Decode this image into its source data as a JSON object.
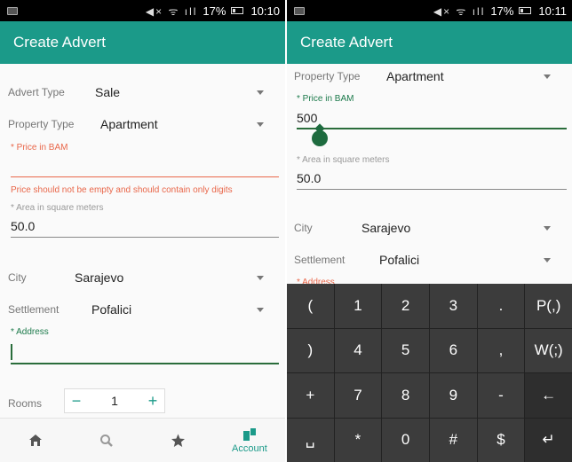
{
  "left": {
    "status": {
      "time": "10:10",
      "battery": "17%",
      "signal_glyphs": "◀× ᯤ ıll"
    },
    "appbar": {
      "title": "Create Advert"
    },
    "advert_type": {
      "label": "Advert Type",
      "value": "Sale"
    },
    "property_type": {
      "label": "Property Type",
      "value": "Apartment"
    },
    "price": {
      "hint": "* Price in BAM",
      "value": "",
      "error": "Price should not be empty and should contain only digits"
    },
    "area": {
      "hint": "* Area in square meters",
      "value": "50.0"
    },
    "city": {
      "label": "City",
      "value": "Sarajevo"
    },
    "settlement": {
      "label": "Settlement",
      "value": "Pofalici"
    },
    "address": {
      "hint": "* Address",
      "value": ""
    },
    "rooms": {
      "label": "Rooms",
      "minus": "−",
      "value": "1",
      "plus": "+"
    },
    "nav": [
      {
        "name": "home",
        "label": ""
      },
      {
        "name": "search",
        "label": ""
      },
      {
        "name": "favorites",
        "label": ""
      },
      {
        "name": "account",
        "label": "Account"
      }
    ]
  },
  "right": {
    "status": {
      "time": "10:11",
      "battery": "17%",
      "signal_glyphs": "◀× ᯤ ıll"
    },
    "appbar": {
      "title": "Create Advert"
    },
    "property_type": {
      "label": "Property Type",
      "value": "Apartment"
    },
    "price": {
      "hint": "* Price in BAM",
      "value": "500"
    },
    "area": {
      "hint": "* Area in square meters",
      "value": "50.0"
    },
    "city": {
      "label": "City",
      "value": "Sarajevo"
    },
    "settlement": {
      "label": "Settlement",
      "value": "Pofalici"
    },
    "address": {
      "hint": "* Address"
    },
    "keyboard": {
      "keys": [
        "(",
        "1",
        "2",
        "3",
        ".",
        "P(,)",
        ")",
        "4",
        "5",
        "6",
        ",",
        "W(;)",
        "+",
        "7",
        "8",
        "9",
        "-",
        "←",
        "␣",
        "*",
        "0",
        "#",
        "$",
        "↵"
      ]
    }
  },
  "colors": {
    "accent": "#1b9a89",
    "error": "#e9674a",
    "focus": "#2a6d3b"
  }
}
